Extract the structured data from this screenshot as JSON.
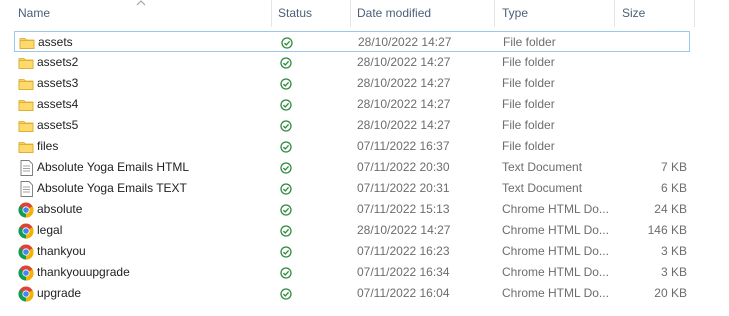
{
  "columns": {
    "name": "Name",
    "status": "Status",
    "date_modified": "Date modified",
    "type": "Type",
    "size": "Size"
  },
  "sort": {
    "column": "name",
    "direction": "ascending"
  },
  "files": [
    {
      "name": "assets",
      "icon": "folder-icon",
      "status": "available",
      "date": "28/10/2022 14:27",
      "type": "File folder",
      "size": ""
    },
    {
      "name": "assets2",
      "icon": "folder-icon",
      "status": "available",
      "date": "28/10/2022 14:27",
      "type": "File folder",
      "size": ""
    },
    {
      "name": "assets3",
      "icon": "folder-icon",
      "status": "available",
      "date": "28/10/2022 14:27",
      "type": "File folder",
      "size": ""
    },
    {
      "name": "assets4",
      "icon": "folder-icon",
      "status": "available",
      "date": "28/10/2022 14:27",
      "type": "File folder",
      "size": ""
    },
    {
      "name": "assets5",
      "icon": "folder-icon",
      "status": "available",
      "date": "28/10/2022 14:27",
      "type": "File folder",
      "size": ""
    },
    {
      "name": "files",
      "icon": "folder-icon",
      "status": "available",
      "date": "07/11/2022 16:37",
      "type": "File folder",
      "size": ""
    },
    {
      "name": "Absolute Yoga Emails HTML",
      "icon": "text-document-icon",
      "status": "available",
      "date": "07/11/2022 20:30",
      "type": "Text Document",
      "size": "7 KB"
    },
    {
      "name": "Absolute Yoga Emails TEXT",
      "icon": "text-document-icon",
      "status": "available",
      "date": "07/11/2022 20:31",
      "type": "Text Document",
      "size": "6 KB"
    },
    {
      "name": "absolute",
      "icon": "chrome-icon",
      "status": "available",
      "date": "07/11/2022 15:13",
      "type": "Chrome HTML Do...",
      "size": "24 KB"
    },
    {
      "name": "legal",
      "icon": "chrome-icon",
      "status": "available",
      "date": "28/10/2022 14:27",
      "type": "Chrome HTML Do...",
      "size": "146 KB"
    },
    {
      "name": "thankyou",
      "icon": "chrome-icon",
      "status": "available",
      "date": "07/11/2022 16:23",
      "type": "Chrome HTML Do...",
      "size": "3 KB"
    },
    {
      "name": "thankyouupgrade",
      "icon": "chrome-icon",
      "status": "available",
      "date": "07/11/2022 16:34",
      "type": "Chrome HTML Do...",
      "size": "3 KB"
    },
    {
      "name": "upgrade",
      "icon": "chrome-icon",
      "status": "available",
      "date": "07/11/2022 16:04",
      "type": "Chrome HTML Do...",
      "size": "20 KB"
    }
  ],
  "focused_row": "assets",
  "colors": {
    "header_text": "#4c607a",
    "focus_border": "#99c9ef",
    "status_green": "#2e8b3c",
    "folder_yellow": "#f7d063"
  }
}
